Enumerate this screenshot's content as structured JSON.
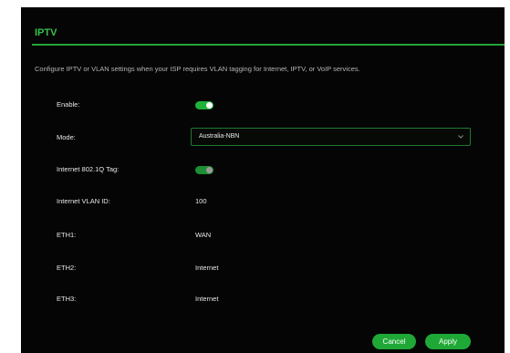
{
  "section": {
    "title": "IPTV",
    "description": "Configure IPTV or VLAN settings when your ISP requires VLAN tagging for Internet, IPTV, or VoIP services."
  },
  "fields": {
    "enable": {
      "label": "Enable:",
      "state": "on"
    },
    "mode": {
      "label": "Mode:",
      "value": "Australia-NBN",
      "icon": "chevron-down-icon"
    },
    "tag": {
      "label": "Internet 802.1Q Tag:",
      "state": "on"
    },
    "vlan_id": {
      "label": "Internet VLAN ID:",
      "value": "100"
    },
    "eth1": {
      "label": "ETH1:",
      "value": "WAN"
    },
    "eth2": {
      "label": "ETH2:",
      "value": "Internet"
    },
    "eth3": {
      "label": "ETH3:",
      "value": "Internet"
    }
  },
  "buttons": {
    "cancel": "Cancel",
    "apply": "Apply"
  },
  "colors": {
    "accent": "#1fa836",
    "background": "#050505"
  }
}
